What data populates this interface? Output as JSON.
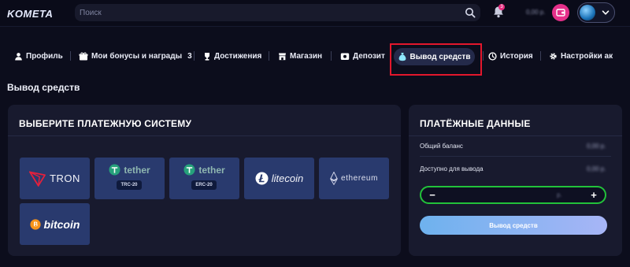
{
  "header": {
    "logo": "KOMETA",
    "search_placeholder": "Поиск",
    "notifications_count": "3",
    "balance_blurred": "0,00 р."
  },
  "tabs": [
    {
      "label": "Профиль",
      "icon": "user-icon"
    },
    {
      "label": "Мои бонусы и награды",
      "icon": "gift-icon",
      "count": "3"
    },
    {
      "label": "Достижения",
      "icon": "trophy-icon"
    },
    {
      "label": "Магазин",
      "icon": "shop-icon"
    },
    {
      "label": "Депозит",
      "icon": "wallet-icon"
    },
    {
      "label": "Вывод средств",
      "icon": "money-bag-icon",
      "active": true
    },
    {
      "label": "История",
      "icon": "clock-icon"
    },
    {
      "label": "Настройки ак",
      "icon": "gear-icon"
    }
  ],
  "page_title": "Вывод средств",
  "payment_systems": {
    "title": "ВЫБЕРИТЕ ПЛАТЕЖНУЮ СИСТЕМУ",
    "items": [
      {
        "name": "TRON"
      },
      {
        "name": "tether",
        "network": "TRC-20"
      },
      {
        "name": "tether",
        "network": "ERC-20"
      },
      {
        "name": "litecoin"
      },
      {
        "name": "ethereum"
      },
      {
        "name": "bitcoin"
      }
    ]
  },
  "payment_data": {
    "title": "ПЛАТЁЖНЫЕ ДАННЫЕ",
    "total_balance_label": "Общий баланс",
    "total_balance_value": "0,00 р.",
    "available_label": "Доступно для вывода",
    "available_value": "0,00 р.",
    "amount_value": "р.",
    "minus": "−",
    "plus": "+",
    "withdraw_button": "Вывод средств"
  },
  "colors": {
    "background": "#0c0d1c",
    "card": "#181a2e",
    "method_tile": "#293a6e",
    "accent_green": "#22c23a",
    "highlight_red": "#e3172c",
    "button_gradient_start": "#6eb2ee",
    "button_gradient_end": "#a7b5f6"
  }
}
